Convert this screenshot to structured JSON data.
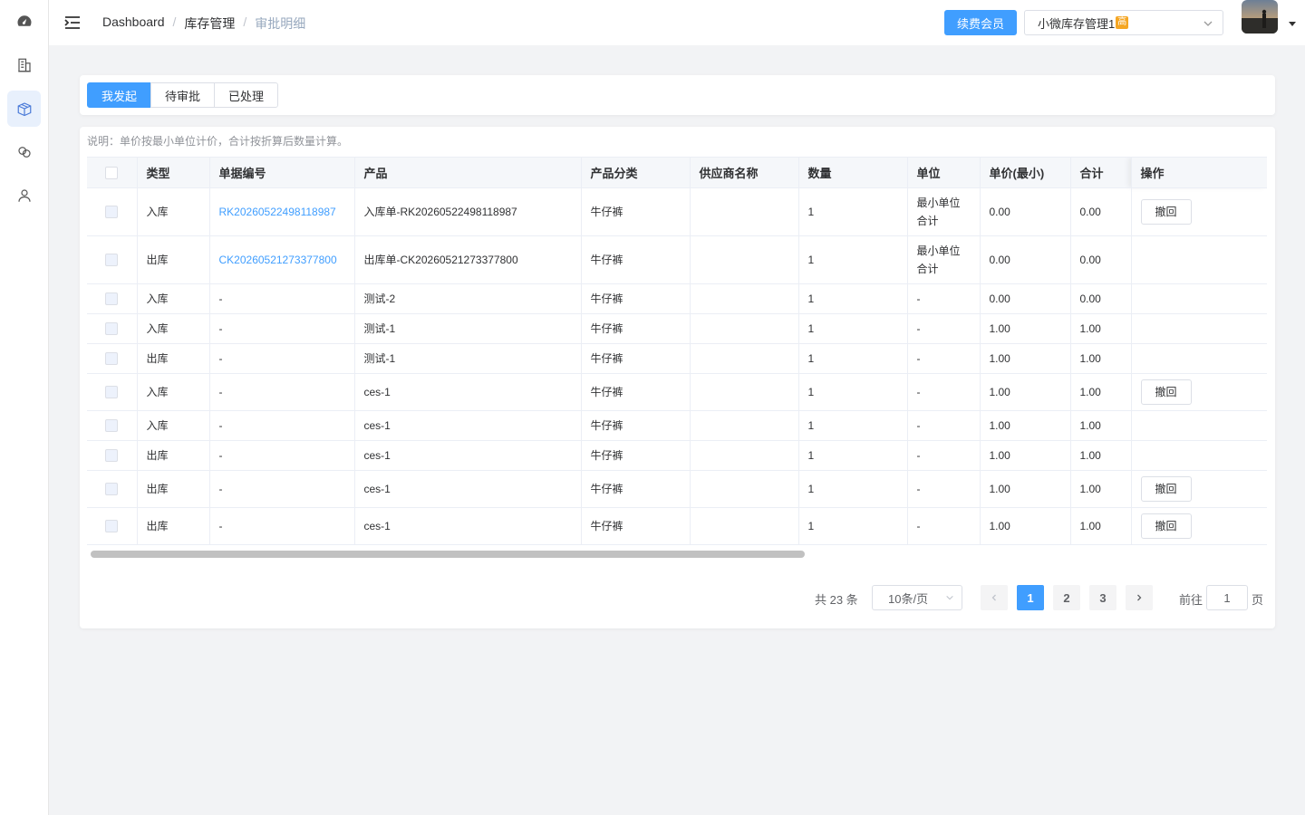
{
  "header": {
    "breadcrumb": [
      "Dashboard",
      "库存管理",
      "审批明细"
    ],
    "renew_label": "续费会员",
    "store_name": "小微库存管理1",
    "vip_badge": "高"
  },
  "sidebar": {
    "items": [
      {
        "icon": "dashboard-icon"
      },
      {
        "icon": "building-icon"
      },
      {
        "icon": "box-icon",
        "active": true
      },
      {
        "icon": "link-icon"
      },
      {
        "icon": "user-icon"
      }
    ]
  },
  "tabs": [
    {
      "label": "我发起",
      "active": true
    },
    {
      "label": "待审批"
    },
    {
      "label": "已处理"
    }
  ],
  "note": "说明：单价按最小单位计价，合计按折算后数量计算。",
  "table": {
    "columns": [
      "类型",
      "单据编号",
      "产品",
      "产品分类",
      "供应商名称",
      "数量",
      "单位",
      "单价(最小)",
      "合计",
      "操作"
    ],
    "revoke_label": "撤回",
    "rows": [
      {
        "type": "入库",
        "code": "RK20260522498118987",
        "product": "入库单-RK20260522498118987",
        "category": "牛仔裤",
        "supplier": "",
        "qty": "1",
        "unit": "最小单位\n合计",
        "price": "0.00",
        "total": "0.00",
        "revoke": true
      },
      {
        "type": "出库",
        "code": "CK20260521273377800",
        "product": "出库单-CK20260521273377800",
        "category": "牛仔裤",
        "supplier": "",
        "qty": "1",
        "unit": "最小单位\n合计",
        "price": "0.00",
        "total": "0.00",
        "revoke": false
      },
      {
        "type": "入库",
        "code": "-",
        "product": "测试-2",
        "category": "牛仔裤",
        "supplier": "",
        "qty": "1",
        "unit": "-",
        "price": "0.00",
        "total": "0.00",
        "revoke": false
      },
      {
        "type": "入库",
        "code": "-",
        "product": "测试-1",
        "category": "牛仔裤",
        "supplier": "",
        "qty": "1",
        "unit": "-",
        "price": "1.00",
        "total": "1.00",
        "revoke": false
      },
      {
        "type": "出库",
        "code": "-",
        "product": "测试-1",
        "category": "牛仔裤",
        "supplier": "",
        "qty": "1",
        "unit": "-",
        "price": "1.00",
        "total": "1.00",
        "revoke": false
      },
      {
        "type": "入库",
        "code": "-",
        "product": "ces-1",
        "category": "牛仔裤",
        "supplier": "",
        "qty": "1",
        "unit": "-",
        "price": "1.00",
        "total": "1.00",
        "revoke": true
      },
      {
        "type": "入库",
        "code": "-",
        "product": "ces-1",
        "category": "牛仔裤",
        "supplier": "",
        "qty": "1",
        "unit": "-",
        "price": "1.00",
        "total": "1.00",
        "revoke": false
      },
      {
        "type": "出库",
        "code": "-",
        "product": "ces-1",
        "category": "牛仔裤",
        "supplier": "",
        "qty": "1",
        "unit": "-",
        "price": "1.00",
        "total": "1.00",
        "revoke": false
      },
      {
        "type": "出库",
        "code": "-",
        "product": "ces-1",
        "category": "牛仔裤",
        "supplier": "",
        "qty": "1",
        "unit": "-",
        "price": "1.00",
        "total": "1.00",
        "revoke": true
      },
      {
        "type": "出库",
        "code": "-",
        "product": "ces-1",
        "category": "牛仔裤",
        "supplier": "",
        "qty": "1",
        "unit": "-",
        "price": "1.00",
        "total": "1.00",
        "revoke": true
      }
    ]
  },
  "pagination": {
    "total_text": "共 23 条",
    "page_size": "10条/页",
    "pages": [
      "1",
      "2",
      "3"
    ],
    "current_page": "1",
    "goto_label": "前往",
    "goto_value": "1",
    "goto_suffix": "页"
  }
}
